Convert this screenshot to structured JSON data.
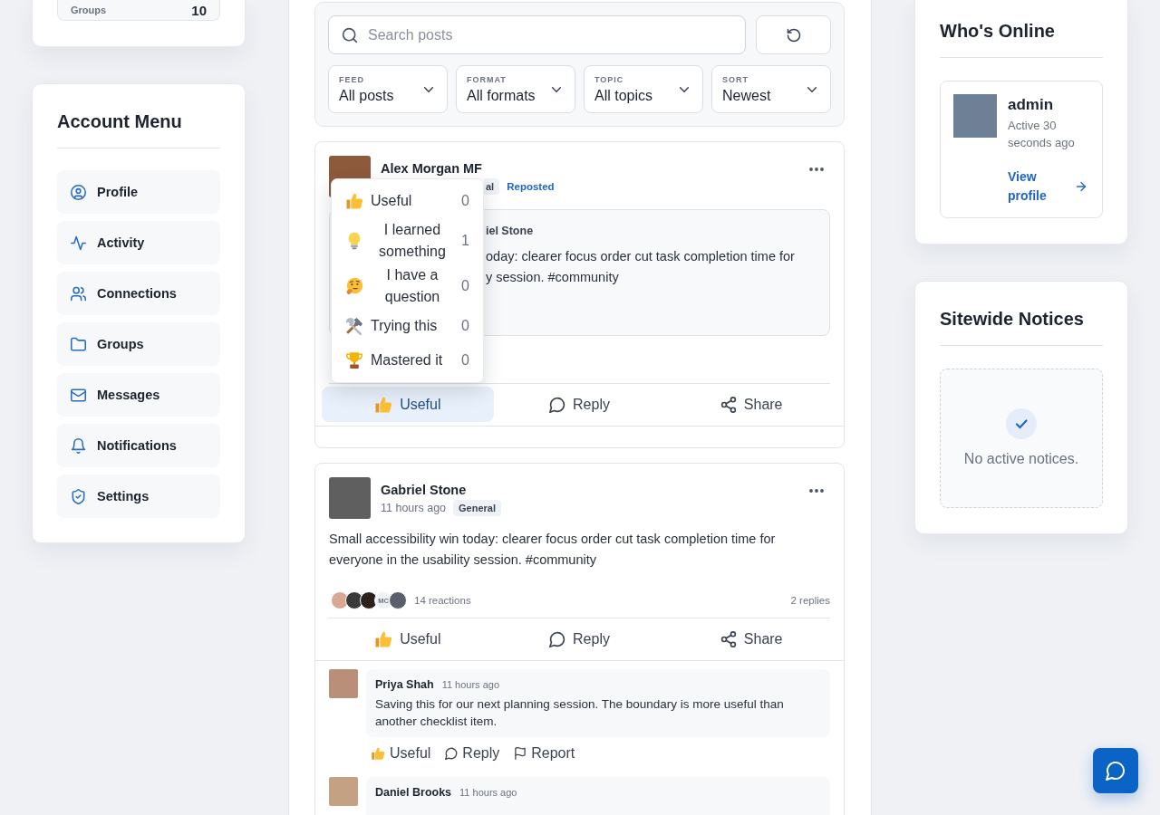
{
  "left_sidebar": {
    "stats": [
      {
        "label": "Groups",
        "value": "10"
      }
    ],
    "account_menu": {
      "title": "Account Menu",
      "items": [
        {
          "kind": "profile",
          "label": "Profile"
        },
        {
          "kind": "activity",
          "label": "Activity"
        },
        {
          "kind": "connections",
          "label": "Connections"
        },
        {
          "kind": "groups",
          "label": "Groups"
        },
        {
          "kind": "messages",
          "label": "Messages"
        },
        {
          "kind": "notifications",
          "label": "Notifications"
        },
        {
          "kind": "settings",
          "label": "Settings"
        }
      ]
    }
  },
  "feed": {
    "filters": {
      "search": {
        "placeholder": "Search posts"
      },
      "dropdowns": [
        {
          "label": "FEED",
          "value": "All posts"
        },
        {
          "label": "FORMAT",
          "value": "All formats"
        },
        {
          "label": "TOPIC",
          "value": "All topics"
        },
        {
          "label": "SORT",
          "value": "Newest"
        }
      ]
    },
    "posts": [
      {
        "author": "Alex Morgan MF",
        "tag": "al",
        "repost_label": "Reposted",
        "quote": {
          "author": "iel Stone",
          "lines": [
            "oday: clearer focus order cut task completion time for",
            "y session. #community"
          ]
        },
        "actions": [
          {
            "kind": "useful",
            "label": "Useful",
            "active": true
          },
          {
            "kind": "reply",
            "label": "Reply",
            "active": false
          },
          {
            "kind": "share",
            "label": "Share",
            "active": false
          }
        ],
        "reaction_picker": {
          "options": [
            {
              "kind": "useful",
              "label": "Useful",
              "count": "0"
            },
            {
              "kind": "learned",
              "label": "I learned something",
              "count": "1"
            },
            {
              "kind": "question",
              "label": "I have a question",
              "count": "0"
            },
            {
              "kind": "trying",
              "label": "Trying this",
              "count": "0"
            },
            {
              "kind": "mastered",
              "label": "Mastered it",
              "count": "0"
            }
          ]
        }
      },
      {
        "author": "Gabriel Stone",
        "time": "11 hours ago",
        "tag": "General",
        "text": "Small accessibility win today: clearer focus order cut task completion time for everyone in the usability session. #community",
        "reactions": {
          "avatars": [
            {
              "kind": "photo"
            },
            {
              "kind": "photo"
            },
            {
              "kind": "photo"
            },
            {
              "kind": "initials",
              "initials": "MC"
            },
            {
              "kind": "photo"
            }
          ],
          "summary": "14 reactions",
          "replies": "2 replies"
        },
        "actions": [
          {
            "kind": "useful",
            "label": "Useful",
            "active": false
          },
          {
            "kind": "reply",
            "label": "Reply",
            "active": false
          },
          {
            "kind": "share",
            "label": "Share",
            "active": false
          }
        ],
        "comments": [
          {
            "author": "Priya Shah",
            "time": "11 hours ago",
            "text": "Saving this for our next planning session. The boundary is more useful than another checklist item.",
            "actions": [
              {
                "kind": "useful",
                "label": "Useful"
              },
              {
                "kind": "reply",
                "label": "Reply"
              },
              {
                "kind": "report",
                "label": "Report"
              }
            ]
          },
          {
            "author": "Daniel Brooks",
            "time": "11 hours ago"
          }
        ]
      }
    ]
  },
  "right_sidebar": {
    "whos_online": {
      "title": "Who's Online",
      "users": [
        {
          "name": "admin",
          "status": "Active 30 seconds ago",
          "link": "View profile"
        }
      ]
    },
    "sitewide_notices": {
      "title": "Sitewide Notices",
      "empty_text": "No active notices."
    }
  }
}
